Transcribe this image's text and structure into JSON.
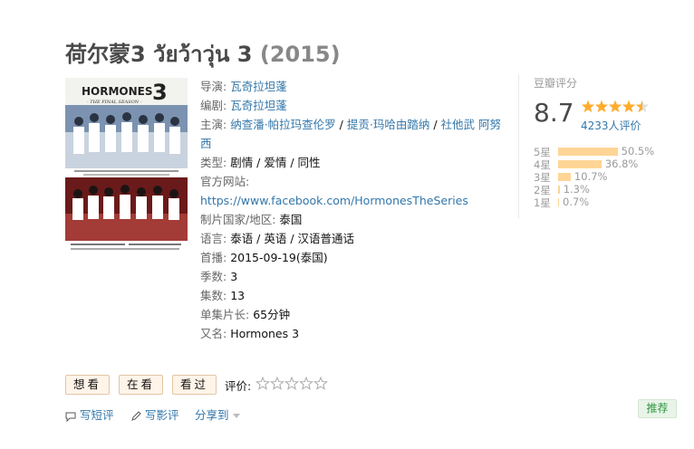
{
  "title": {
    "main": "荷尔蒙3 วัยว้าวุ่น 3",
    "year": "(2015)"
  },
  "poster": {
    "title_text": "HORMONES",
    "number": "3",
    "subtitle": "- THE FINAL SEASON -"
  },
  "info": {
    "director_label": "导演:",
    "director": "瓦奇拉坦蓬",
    "writer_label": "编剧:",
    "writer": "瓦奇拉坦蓬",
    "cast_label": "主演:",
    "cast": [
      "纳查潘·帕拉玛查伦罗",
      "提贡·玛哈由踏纳",
      "社他武 阿努西"
    ],
    "cast_sep": " / ",
    "genre_label": "类型:",
    "genre": "剧情 / 爱情 / 同性",
    "website_label": "官方网站:",
    "website": "https://www.facebook.com/HormonesTheSeries",
    "country_label": "制片国家/地区:",
    "country": "泰国",
    "language_label": "语言:",
    "language": "泰语 / 英语 / 汉语普通话",
    "premiere_label": "首播:",
    "premiere": "2015-09-19(泰国)",
    "seasons_label": "季数:",
    "seasons": "3",
    "episodes_label": "集数:",
    "episodes": "13",
    "runtime_label": "单集片长:",
    "runtime": "65分钟",
    "aka_label": "又名:",
    "aka": "Hormones 3"
  },
  "rating": {
    "label": "豆瓣评分",
    "score": "8.7",
    "stars_filled": 4.5,
    "votes": "4233人评价",
    "distribution": [
      {
        "label": "5星",
        "pct": "50.5%",
        "value": 50.5
      },
      {
        "label": "4星",
        "pct": "36.8%",
        "value": 36.8
      },
      {
        "label": "3星",
        "pct": "10.7%",
        "value": 10.7
      },
      {
        "label": "2星",
        "pct": "1.3%",
        "value": 1.3
      },
      {
        "label": "1星",
        "pct": "0.7%",
        "value": 0.7
      }
    ]
  },
  "actions": {
    "want": "想看",
    "watching": "在看",
    "watched": "看过",
    "rate_label": "评价:"
  },
  "links": {
    "short_review": "写短评",
    "review": "写影评",
    "share": "分享到"
  },
  "recommend": "推荐",
  "colors": {
    "link": "#3377aa",
    "star": "#ffac2d",
    "bar": "#ffd596",
    "button_bg": "#fff4e8",
    "recommend_text": "#2e963d"
  }
}
